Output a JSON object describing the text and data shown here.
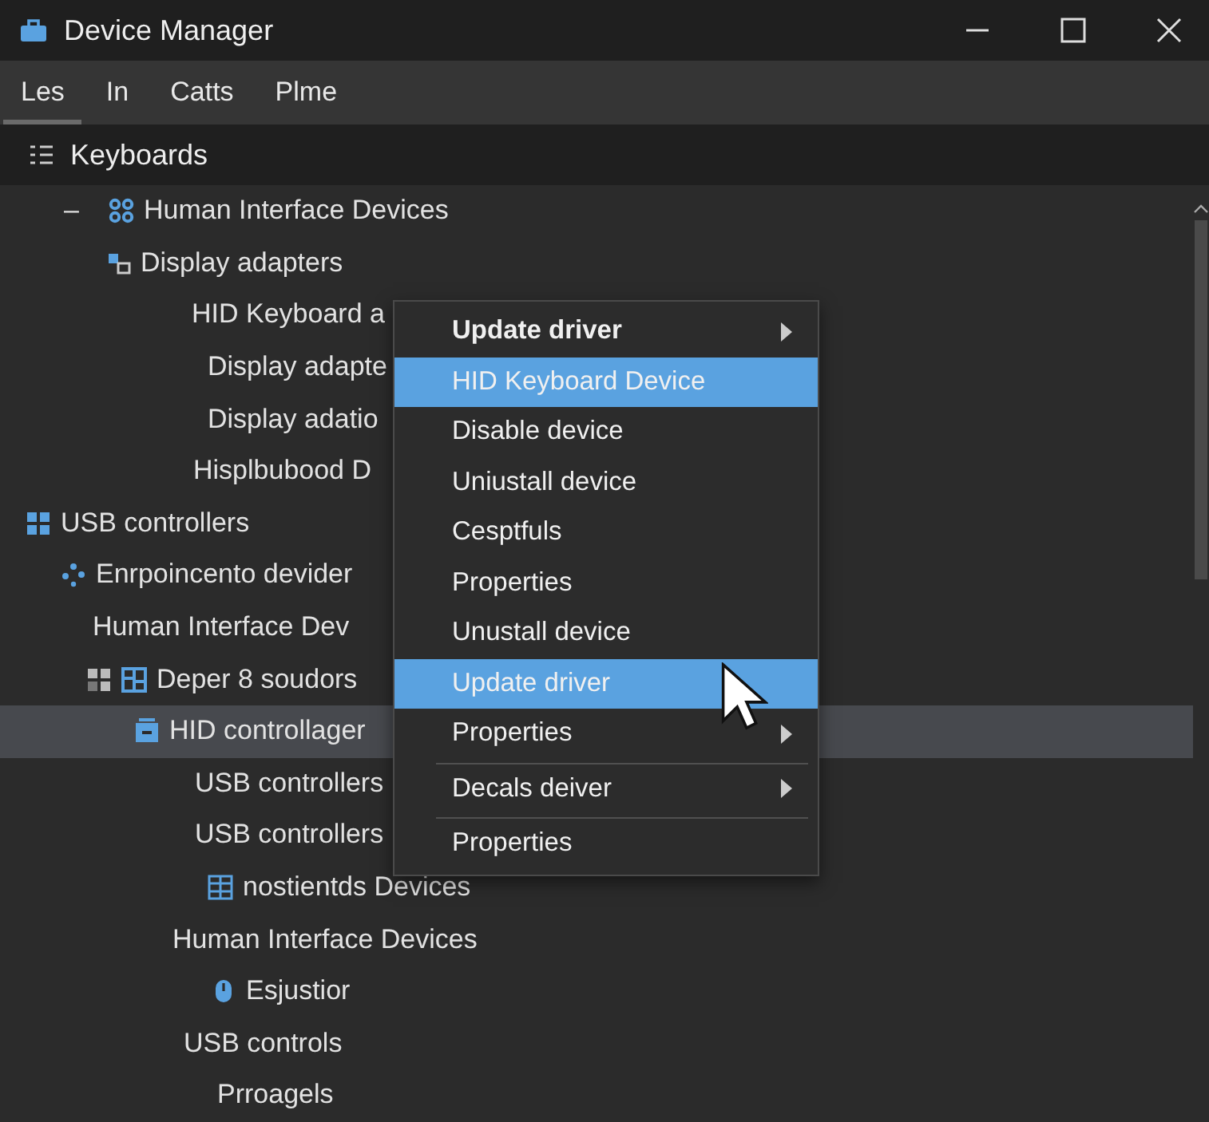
{
  "window": {
    "title": "Device Manager"
  },
  "menu_bar": [
    {
      "label": "Les",
      "selected": true
    },
    {
      "label": "In",
      "selected": false
    },
    {
      "label": "Catts",
      "selected": false
    },
    {
      "label": "Plme",
      "selected": false
    }
  ],
  "toolbar": {
    "label": "Keyboards"
  },
  "tree": [
    {
      "label": "Human Interface Devices",
      "toggle": "–",
      "selected": false,
      "children": [
        {
          "label": "Display adapters",
          "selected": false,
          "children": [
            {
              "label": "HID Keyboard a",
              "selected": false
            },
            {
              "label": "Display adapte",
              "selected": false
            },
            {
              "label": "Display adatio",
              "selected": false
            },
            {
              "label": "Hisplbubood D",
              "selected": false
            }
          ]
        }
      ]
    },
    {
      "label": "USB controllers",
      "selected": false,
      "children": [
        {
          "label": "Enrpoincento devider",
          "selected": false,
          "children": [
            {
              "label": "Human Interface Dev",
              "selected": false
            },
            {
              "label": "Deper 8 soudors",
              "selected": false,
              "children": [
                {
                  "label": "HID controllager",
                  "selected": true,
                  "children": [
                    {
                      "label": "USB controllers",
                      "selected": false
                    },
                    {
                      "label": "USB controllers",
                      "selected": false
                    },
                    {
                      "label": "nostientds Devices",
                      "selected": false
                    }
                  ]
                }
              ]
            },
            {
              "label": "Human Interface Devices",
              "selected": false,
              "children": [
                {
                  "label": "Esjustior",
                  "selected": false
                }
              ]
            },
            {
              "label": "USB controls",
              "selected": false,
              "children": [
                {
                  "label": "Prroagels",
                  "selected": false
                }
              ]
            }
          ]
        }
      ]
    }
  ],
  "context_menu": [
    {
      "label": "Update driver",
      "bold": true,
      "submenu": true,
      "selected": false,
      "separator_before": false
    },
    {
      "label": "HID Keyboard Device",
      "bold": false,
      "submenu": false,
      "selected": true,
      "separator_before": false
    },
    {
      "label": "Disable device",
      "bold": false,
      "submenu": false,
      "selected": false,
      "separator_before": false
    },
    {
      "label": "Uniustall device",
      "bold": false,
      "submenu": false,
      "selected": false,
      "separator_before": false
    },
    {
      "label": "Cesptfuls",
      "bold": false,
      "submenu": false,
      "selected": false,
      "separator_before": false
    },
    {
      "label": "Properties",
      "bold": false,
      "submenu": false,
      "selected": false,
      "separator_before": false
    },
    {
      "label": "Unustall device",
      "bold": false,
      "submenu": false,
      "selected": false,
      "separator_before": false
    },
    {
      "label": "Update driver",
      "bold": false,
      "submenu": false,
      "selected": true,
      "separator_before": false
    },
    {
      "label": "Properties",
      "bold": false,
      "submenu": true,
      "selected": false,
      "separator_before": false
    },
    {
      "label": "Decals deiver",
      "bold": false,
      "submenu": true,
      "selected": false,
      "separator_before": true
    },
    {
      "label": "Properties",
      "bold": false,
      "submenu": false,
      "selected": false,
      "separator_before": true
    }
  ]
}
